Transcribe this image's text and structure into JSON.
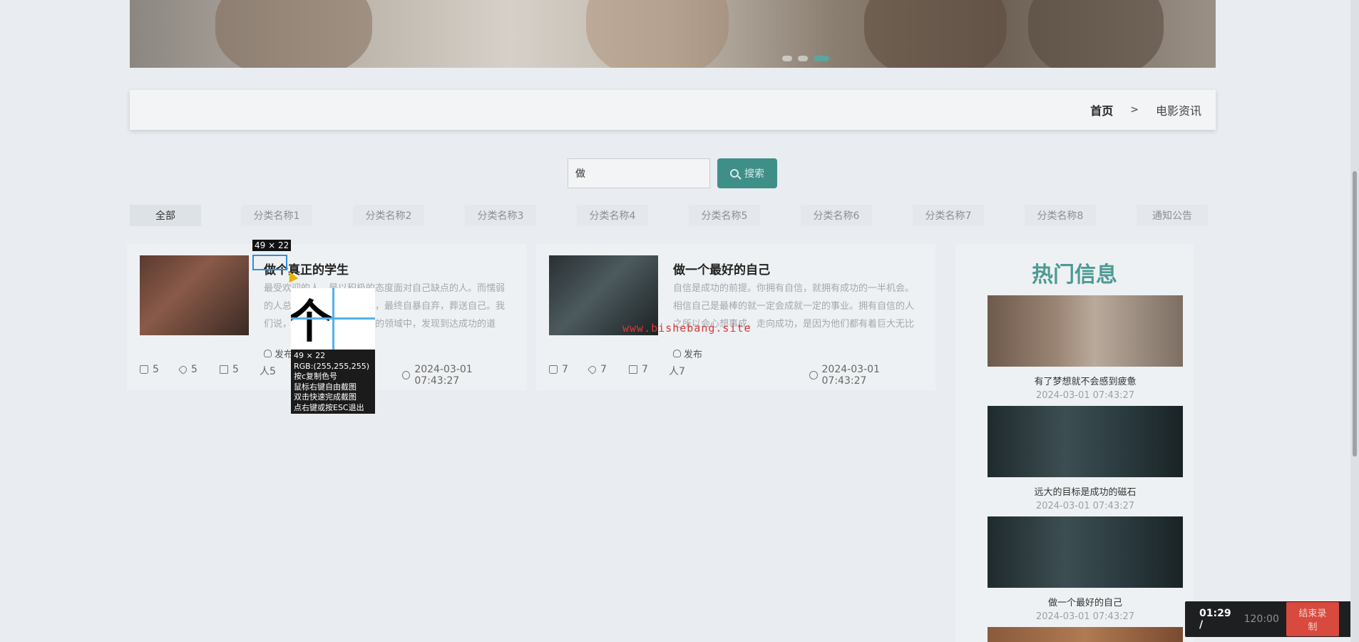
{
  "breadcrumb": {
    "home": "首页",
    "sep": ">",
    "current": "电影资讯"
  },
  "search": {
    "value": "做",
    "button_label": "搜索"
  },
  "categories": [
    "全部",
    "分类名称1",
    "分类名称2",
    "分类名称3",
    "分类名称4",
    "分类名称5",
    "分类名称6",
    "分类名称7",
    "分类名称8",
    "通知公告"
  ],
  "articles": [
    {
      "title": "做个真正的学生",
      "desc": "最受欢迎的人，是以积极的态度面对自己缺点的人。而懦弱的人总是想掩饰自己的缺点，最终自暴自弃，葬送自己。我们说，正是他们都能从失败的领域中，发现到达成功的道路，充满自信心。我们身上的每一个缺点都有可能...",
      "publish": "发布",
      "likes": "5",
      "favs": "5",
      "comments": "5",
      "views": "人5",
      "time": "2024-03-01 07:43:27"
    },
    {
      "title": "做一个最好的自己",
      "desc": "自信是成功的前提。你拥有自信，就拥有成功的一半机会。相信自己是最棒的就一定会成就一定的事业。拥有自信的人之所以会心想事成、走向成功，是因为他们都有着巨大无比的潜能等着去开发消极失败的心态之所...",
      "publish": "发布",
      "likes": "7",
      "favs": "7",
      "comments": "7",
      "views": "人7",
      "time": "2024-03-01 07:43:27"
    }
  ],
  "hot": {
    "title": "热门信息",
    "items": [
      {
        "name": "有了梦想就不会感到疲惫",
        "date": "2024-03-01 07:43:27"
      },
      {
        "name": "远大的目标是成功的磁石",
        "date": "2024-03-01 07:43:27"
      },
      {
        "name": "做一个最好的自己",
        "date": "2024-03-01 07:43:27"
      }
    ]
  },
  "watermark": "www.bishebang.site",
  "capture_tool": {
    "size": "49 × 22",
    "zoom_chars": "个真",
    "info": [
      "49 × 22",
      "RGB:(255,255,255)",
      "按c复制色号",
      "鼠标右键自由截图",
      "双击快速完成截图",
      "点右键或按ESC退出"
    ]
  },
  "recorder": {
    "elapsed": "01:29 /",
    "total": "120:00",
    "stop_label": "结束录制"
  },
  "colors": {
    "accent": "#4e9a94",
    "button": "#3f8f89",
    "stop": "#d8493e"
  }
}
